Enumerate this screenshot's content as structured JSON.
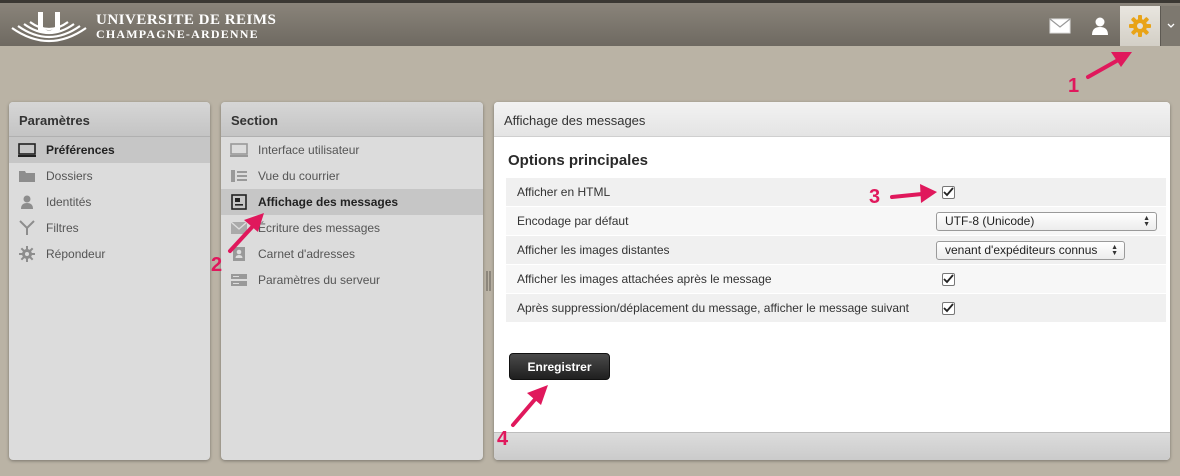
{
  "header": {
    "brand_line1": "UNIVERSITE DE REIMS",
    "brand_line2": "CHAMPAGNE-ARDENNE",
    "icons": [
      "mail-icon",
      "user-icon",
      "gear-icon",
      "chevron-down-icon"
    ]
  },
  "settings_panel": {
    "title": "Paramètres",
    "items": [
      {
        "label": "Préférences",
        "icon": "monitor-icon",
        "selected": true
      },
      {
        "label": "Dossiers",
        "icon": "folder-icon"
      },
      {
        "label": "Identités",
        "icon": "person-icon"
      },
      {
        "label": "Filtres",
        "icon": "filter-icon"
      },
      {
        "label": "Répondeur",
        "icon": "gear-icon"
      }
    ]
  },
  "section_panel": {
    "title": "Section",
    "items": [
      {
        "label": "Interface utilisateur",
        "icon": "monitor-icon"
      },
      {
        "label": "Vue du courrier",
        "icon": "list-icon"
      },
      {
        "label": "Affichage des messages",
        "icon": "message-icon",
        "selected": true
      },
      {
        "label": "Écriture des messages",
        "icon": "envelope-icon"
      },
      {
        "label": "Carnet d'adresses",
        "icon": "address-book-icon"
      },
      {
        "label": "Paramètres du serveur",
        "icon": "server-icon"
      }
    ]
  },
  "content": {
    "title": "Affichage des messages",
    "section_title": "Options principales",
    "rows": [
      {
        "label": "Afficher en HTML",
        "type": "checkbox",
        "checked": true
      },
      {
        "label": "Encodage par défaut",
        "type": "select",
        "value": "UTF-8 (Unicode)"
      },
      {
        "label": "Afficher les images distantes",
        "type": "select",
        "value": "venant d'expéditeurs connus"
      },
      {
        "label": "Afficher les images attachées après le message",
        "type": "checkbox",
        "checked": true
      },
      {
        "label": "Après suppression/déplacement du message, afficher le message suivant",
        "type": "checkbox",
        "checked": true
      }
    ],
    "save_label": "Enregistrer"
  },
  "callouts": [
    "1",
    "2",
    "3",
    "4"
  ],
  "colors": {
    "accent_arrow": "#e0185c",
    "header": "#7a756c",
    "background": "#bab3a5",
    "gear": "#e8a317"
  }
}
